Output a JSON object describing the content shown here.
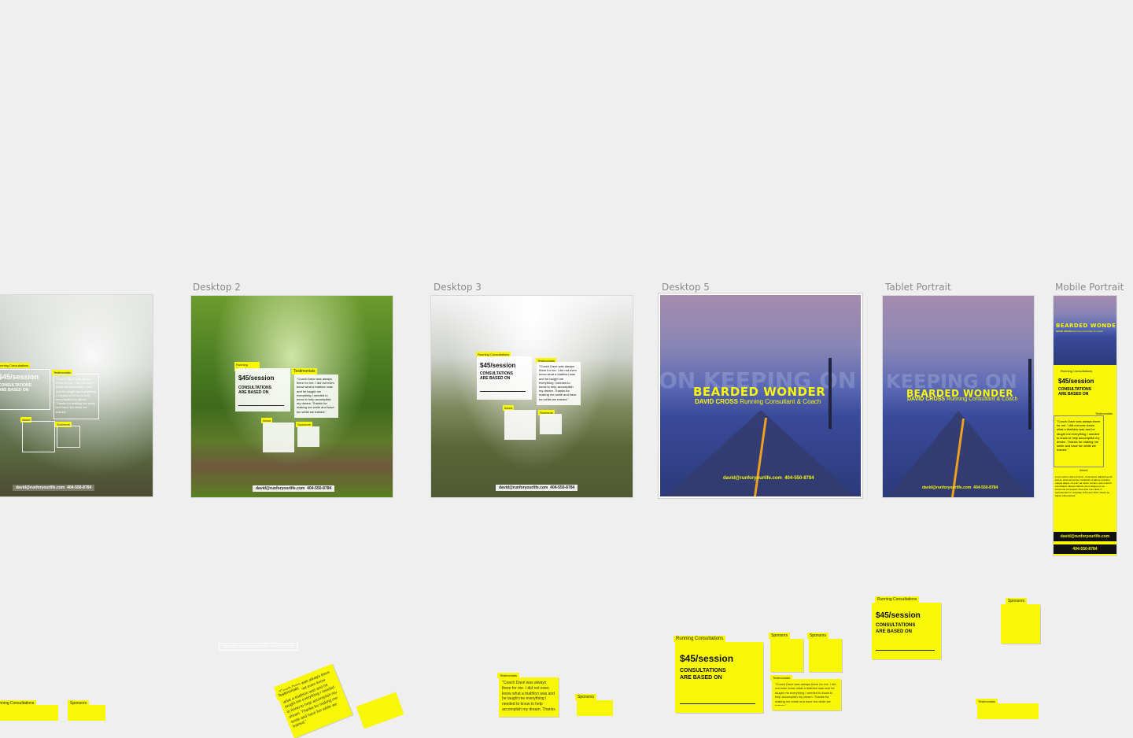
{
  "artboards": {
    "desktop2": "Desktop 2",
    "desktop3": "Desktop 3",
    "desktop5": "Desktop 5",
    "tablet": "Tablet Portrait",
    "mobile": "Mobile Portrait"
  },
  "content": {
    "price": "$45/session",
    "consultations_line1": "CONSULTATIONS",
    "consultations_line2": "ARE BASED ON",
    "tag_running": "Running Consultations",
    "tag_testimonials": "Testimonials",
    "tag_about": "About",
    "tag_sponsors": "Sponsors",
    "testimonial": "\"Coach Dave was always there for me. I did not even know what a triathlon was and he taught me everything I needed to know to help accomplish my dream. Thanks for making me smile and have fun while we trained.\"",
    "testimonial_author": "Athlete Name",
    "email": "david@runforyourlife.com",
    "phone": "404-550-8784",
    "title": "BEARDED WONDER",
    "name": "DAVID CROSS",
    "role": "Running Consultant & Coach",
    "bg_text": "ON KEEPING ON",
    "bg_text_tablet": "KEEPING ON",
    "about_text": "Lorem ipsum dolor sit amet, consectetur adipiscing elit, sed do eiusmod tempor incididunt ut labore et dolore magna aliqua. Ut enim ad minim veniam, quis nostrud exercitation ullamco laboris nisi ut aliquip ex ea commodo consequat. Duis aute irure dolor in reprehenderit in voluptate velit esse cillum dolore eu fugiat nulla pariatur."
  },
  "colors": {
    "canvas": "#efefef",
    "accent": "#f7f707",
    "label": "#8a8a8a"
  }
}
